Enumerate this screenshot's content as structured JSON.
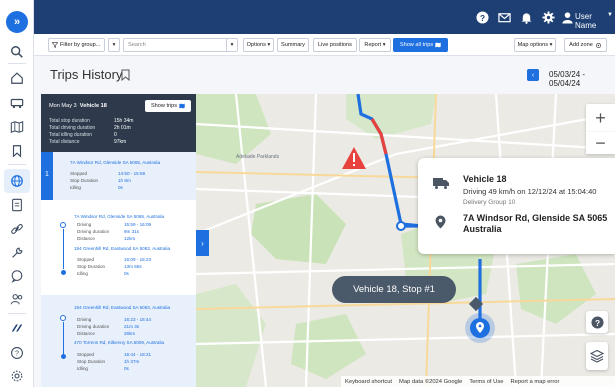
{
  "topbar": {
    "user_label": "User Name",
    "icons": [
      "help-icon",
      "mail-icon",
      "bell-icon",
      "gear-icon",
      "user-icon"
    ]
  },
  "toolbar": {
    "filter_label": "Filter by group...",
    "search_placeholder": "Search",
    "options_label": "Options",
    "summary_label": "Summary",
    "live_positions_label": "Live positions",
    "report_label": "Report",
    "show_all_trips_label": "Show all trips",
    "map_options_label": "Map options",
    "add_zone_label": "Add zone"
  },
  "page": {
    "title": "Trips History",
    "date_range": "05/03/24 - 05/04/24"
  },
  "summary": {
    "date": "Mon May 3",
    "vehicle": "Vehicle 18",
    "show_trips_label": "Show trips",
    "rows": [
      {
        "label": "Total stop duration",
        "value": "15h 34m"
      },
      {
        "label": "Total driving duration",
        "value": "2h 01m"
      },
      {
        "label": "Total idling duration",
        "value": "0"
      },
      {
        "label": "Total distance",
        "value": "97km"
      }
    ]
  },
  "trips": [
    {
      "number": "1",
      "address": "7A Windsor Rd, Glenside SA 5065, Australia",
      "rows": [
        {
          "label": "Stopped",
          "value": "14:50 - 15:59"
        },
        {
          "label": "Stop Duration",
          "value": "1h 8m"
        },
        {
          "label": "Idling",
          "value": "0s"
        }
      ]
    },
    {
      "address": "7A Windsor Rd, Glenside SA 5065, Australia",
      "rows": [
        {
          "label": "Driving",
          "value": "15:59 - 16:09"
        },
        {
          "label": "Driving duration",
          "value": "9m 31s"
        },
        {
          "label": "Distance",
          "value": "12km"
        }
      ],
      "address2": "194 Greenhill Rd, Eastwood SA 5063, Australia",
      "rows2": [
        {
          "label": "Stopped",
          "value": "16:09 - 16:23"
        },
        {
          "label": "Stop Duration",
          "value": "13m 55s"
        },
        {
          "label": "Idling",
          "value": "0s"
        }
      ]
    },
    {
      "address": "194 Greenhill Rd, Eastwood SA 5063, Australia",
      "rows": [
        {
          "label": "Driving",
          "value": "16:23 - 16:44"
        },
        {
          "label": "Driving duration",
          "value": "21m 3s"
        },
        {
          "label": "Distance",
          "value": "26km"
        }
      ],
      "address2": "470 Torrens Rd, Kilkenny SA 5009, Australia",
      "rows2": [
        {
          "label": "Stopped",
          "value": "16:44 - 18:21"
        },
        {
          "label": "Stop Duration",
          "value": "1h 37m"
        },
        {
          "label": "Idling",
          "value": "0s"
        }
      ]
    }
  ],
  "vehicle_card": {
    "title": "Vehicle 18",
    "status": "Driving 49 km/h on 12/12/24 at 15:04:40",
    "group": "Delivery Group 10",
    "address_line1": "7A Windsor Rd, Glenside SA 5065",
    "address_line2": "Australia"
  },
  "map": {
    "stop_tooltip": "Vehicle 18, Stop #1",
    "attribution": [
      "Keyboard shortcut",
      "Map data ©2024 Google",
      "Terms of Use",
      "Report a map error"
    ],
    "zoom_in": "+",
    "zoom_out": "−"
  },
  "colors": {
    "primary": "#1e6fe0",
    "topbar": "#1d3f73",
    "summary_bg": "#2e3a4b",
    "route_alert": "#e8423f"
  }
}
